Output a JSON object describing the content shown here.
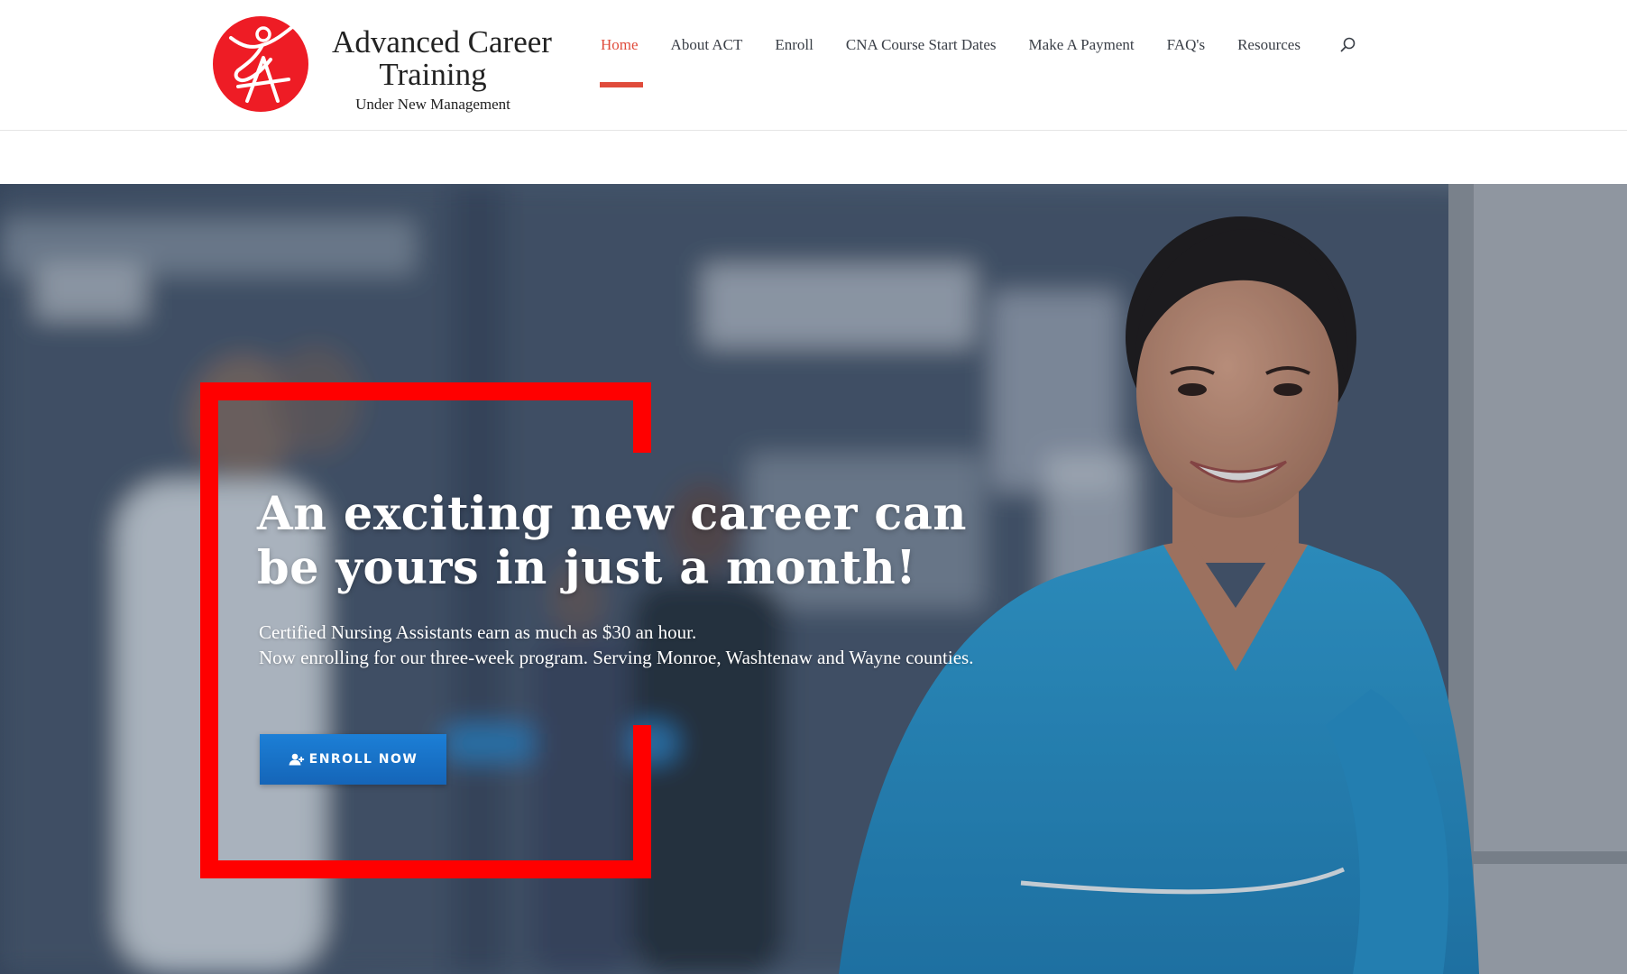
{
  "logo": {
    "line1": "Advanced Career",
    "line2": "Training",
    "line3": "Under New Management",
    "icon": "act-logo-icon",
    "color": "#ee1c25"
  },
  "nav": {
    "items": [
      {
        "label": "Home",
        "active": true
      },
      {
        "label": "About ACT"
      },
      {
        "label": "Enroll"
      },
      {
        "label": "CNA Course Start Dates"
      },
      {
        "label": "Make A Payment"
      },
      {
        "label": "FAQ's"
      },
      {
        "label": "Resources"
      }
    ],
    "search_icon": "search-icon",
    "active_color": "#e04b3b"
  },
  "hero": {
    "title_line1": "An exciting new career can",
    "title_line2": "be yours in just a month!",
    "sub_line1": "Certified Nursing Assistants earn as much as $30 an hour.",
    "sub_line2": "Now enrolling for our three-week program. Serving Monroe, Washtenaw and Wayne counties.",
    "button_label": "ENROLL NOW",
    "button_icon": "add-user-icon",
    "frame_color": "#ff0000",
    "button_color": "#1a73cc"
  }
}
